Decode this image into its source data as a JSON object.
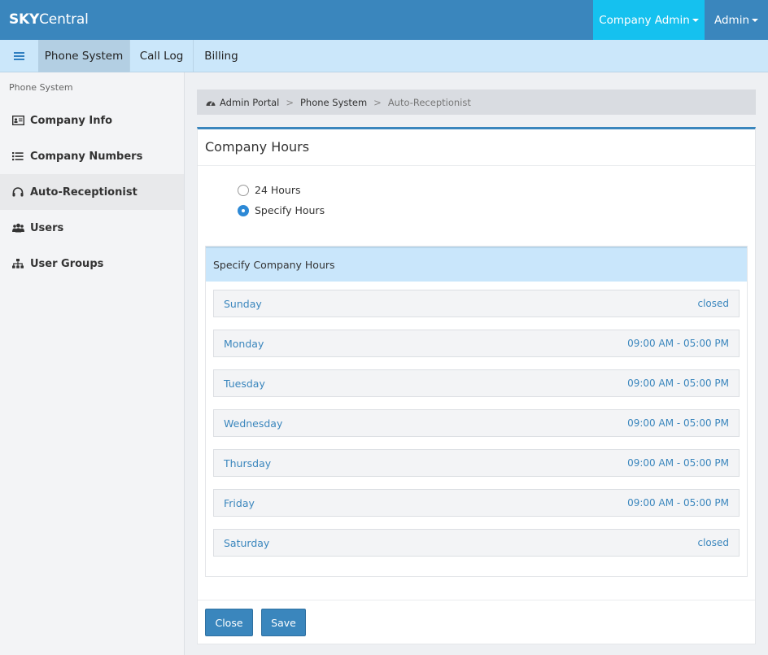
{
  "topbar": {
    "brand_bold": "SKY",
    "brand_rest": "Central",
    "company_admin_label": "Company Admin",
    "admin_label": "Admin"
  },
  "nav": {
    "tabs": [
      {
        "label": "Phone System"
      },
      {
        "label": "Call Log"
      },
      {
        "label": "Billing"
      }
    ]
  },
  "sidebar": {
    "header": "Phone System",
    "items": [
      {
        "label": "Company Info",
        "icon": "id-card-icon"
      },
      {
        "label": "Company Numbers",
        "icon": "list-icon"
      },
      {
        "label": "Auto-Receptionist",
        "icon": "headphones-icon",
        "active": true
      },
      {
        "label": "Users",
        "icon": "users-icon"
      },
      {
        "label": "User Groups",
        "icon": "sitemap-icon"
      }
    ]
  },
  "breadcrumb": {
    "items": [
      "Admin Portal",
      "Phone System",
      "Auto-Receptionist"
    ],
    "separator": ">"
  },
  "panel": {
    "title": "Company Hours",
    "options": [
      {
        "label": "24 Hours",
        "checked": false
      },
      {
        "label": "Specify Hours",
        "checked": true
      }
    ],
    "hours_header": "Specify Company Hours",
    "days": [
      {
        "day": "Sunday",
        "hours": "closed"
      },
      {
        "day": "Monday",
        "hours": "09:00 AM - 05:00 PM"
      },
      {
        "day": "Tuesday",
        "hours": "09:00 AM - 05:00 PM"
      },
      {
        "day": "Wednesday",
        "hours": "09:00 AM - 05:00 PM"
      },
      {
        "day": "Thursday",
        "hours": "09:00 AM - 05:00 PM"
      },
      {
        "day": "Friday",
        "hours": "09:00 AM - 05:00 PM"
      },
      {
        "day": "Saturday",
        "hours": "closed"
      }
    ],
    "close_label": "Close",
    "save_label": "Save"
  },
  "colors": {
    "topbar": "#3a86bd",
    "company_admin_bg": "#15c1ef",
    "navbar": "#cbe7fa",
    "link": "#3a86bd",
    "radio_checked": "#2d89d6"
  }
}
